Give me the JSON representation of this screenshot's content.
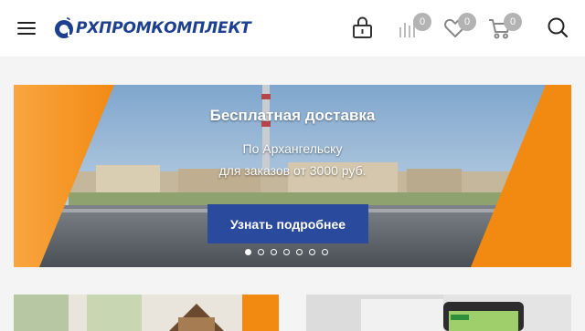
{
  "header": {
    "logo_text": "РХПРОМКОМПЛЕКТ",
    "icons": {
      "menu": "hamburger-menu-icon",
      "account": "lock-icon",
      "compare": "bar-chart-icon",
      "favorites": "heart-icon",
      "cart": "cart-icon",
      "search": "search-icon"
    },
    "compare_count": "0",
    "favorites_count": "0",
    "cart_count": "0"
  },
  "banner": {
    "title": "Бесплатная доставка",
    "subtitle_line1": "По Архангельску",
    "subtitle_line2": "для заказов от 3000 руб.",
    "button_label": "Узнать подробнее",
    "slide_count": 7,
    "active_slide": 1
  },
  "colors": {
    "brand_blue": "#1c3f8f",
    "button_blue": "#2a4a9e",
    "accent_orange": "#f7931e",
    "badge_gray": "#b3b3b3"
  }
}
